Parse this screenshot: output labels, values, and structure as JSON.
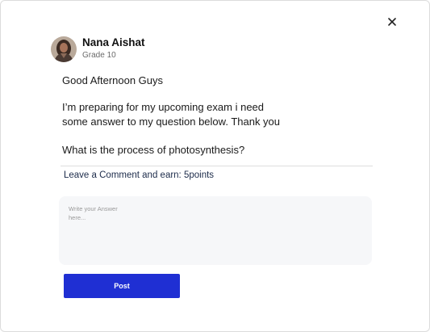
{
  "user": {
    "name": "Nana Aishat",
    "grade": "Grade 10"
  },
  "post": {
    "greeting": "Good Afternoon Guys",
    "body_line1": "I’m preparing for my upcoming exam i need",
    "body_line2": "some answer to my question below. Thank you",
    "question": "What is the process of photosynthesis?"
  },
  "comment": {
    "prompt": "Leave a Comment and earn: 5points",
    "placeholder": "Write your Answer\nhere...",
    "value": ""
  },
  "actions": {
    "post_label": "Post",
    "close_icon": "close-icon"
  },
  "colors": {
    "accent": "#1f2fd3",
    "prompt_text": "#1c2b4a",
    "input_bg": "#f6f7f9"
  }
}
